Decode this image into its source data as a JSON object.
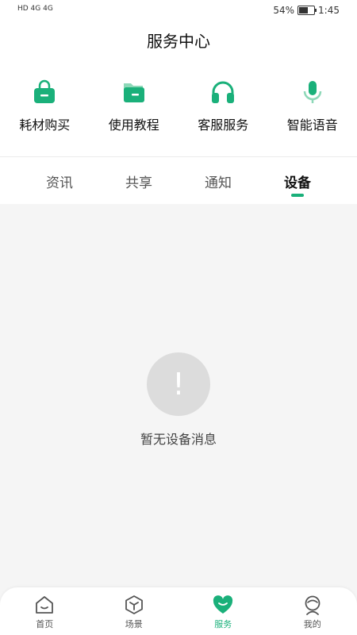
{
  "status_bar": {
    "left": "HD 4G 4G",
    "battery": "54%",
    "time": "1:45"
  },
  "header": {
    "title": "服务中心"
  },
  "quick_actions": [
    {
      "label": "耗材购买",
      "icon": "shopping-bag-icon"
    },
    {
      "label": "使用教程",
      "icon": "folder-icon"
    },
    {
      "label": "客服服务",
      "icon": "headphones-icon"
    },
    {
      "label": "智能语音",
      "icon": "microphone-icon"
    }
  ],
  "tabs": [
    {
      "label": "资讯",
      "active": false
    },
    {
      "label": "共享",
      "active": false
    },
    {
      "label": "通知",
      "active": false
    },
    {
      "label": "设备",
      "active": true
    }
  ],
  "empty_state": {
    "icon": "!",
    "message": "暂无设备消息"
  },
  "bottom_nav": [
    {
      "label": "首页",
      "icon": "home-icon"
    },
    {
      "label": "场景",
      "icon": "cube-icon"
    },
    {
      "label": "服务",
      "icon": "heart-icon"
    },
    {
      "label": "我的",
      "icon": "profile-icon"
    }
  ],
  "colors": {
    "accent": "#1ab07a",
    "accent_light": "#8dd8b8"
  }
}
